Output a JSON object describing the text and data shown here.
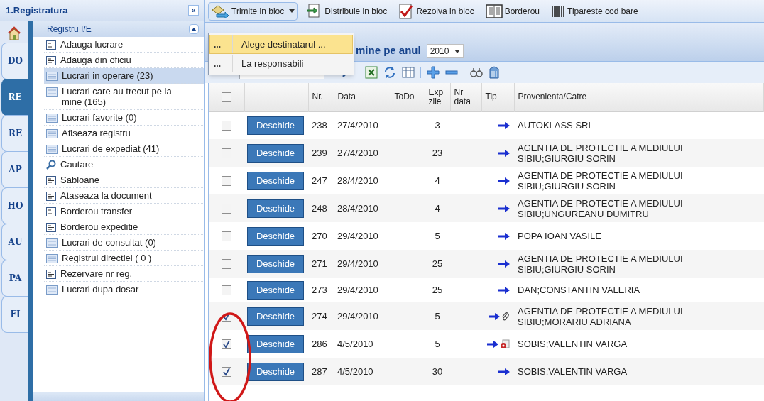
{
  "sidebar": {
    "title": "1.Registratura",
    "collapse": "«",
    "tabs": [
      {
        "label": "DO",
        "selected": false
      },
      {
        "label": "RE",
        "selected": true
      },
      {
        "label": "RE",
        "selected": false
      },
      {
        "label": "AP",
        "selected": false
      },
      {
        "label": "HO",
        "selected": false
      },
      {
        "label": "AU",
        "selected": false
      },
      {
        "label": "PA",
        "selected": false
      },
      {
        "label": "FI",
        "selected": false
      }
    ],
    "panel": {
      "title": "Registru I/E",
      "expanded": true,
      "items": [
        {
          "label": "Adauga lucrare",
          "kind": "form",
          "selected": false
        },
        {
          "label": "Adauga din oficiu",
          "kind": "form",
          "selected": false
        },
        {
          "label": "Lucrari in operare (23)",
          "kind": "list",
          "selected": true
        },
        {
          "label": "Lucrari care au trecut pe la mine (165)",
          "kind": "list",
          "selected": false
        },
        {
          "label": "Lucrari favorite (0)",
          "kind": "list",
          "selected": false
        },
        {
          "label": "Afiseaza registru",
          "kind": "list",
          "selected": false
        },
        {
          "label": "Lucrari de expediat (41)",
          "kind": "list",
          "selected": false
        },
        {
          "label": "Cautare",
          "kind": "search",
          "selected": false
        },
        {
          "label": "Sabloane",
          "kind": "form",
          "selected": false
        },
        {
          "label": "Ataseaza la document",
          "kind": "form",
          "selected": false
        },
        {
          "label": "Borderou transfer",
          "kind": "form",
          "selected": false
        },
        {
          "label": "Borderou expeditie",
          "kind": "form",
          "selected": false
        },
        {
          "label": "Lucrari de consultat (0)",
          "kind": "list",
          "selected": false
        },
        {
          "label": "Registrul directiei ( 0 )",
          "kind": "list",
          "selected": false
        },
        {
          "label": "Rezervare nr reg.",
          "kind": "form",
          "selected": false
        },
        {
          "label": "Lucrari dupa dosar",
          "kind": "list",
          "selected": false
        }
      ]
    }
  },
  "toolbar": [
    {
      "label": "Trimite in bloc",
      "kind": "send",
      "dropdown": true
    },
    {
      "label": "Distribuie in bloc",
      "kind": "distribute",
      "dropdown": false
    },
    {
      "label": "Rezolva in bloc",
      "kind": "resolve",
      "dropdown": false
    },
    {
      "label": "Borderou",
      "kind": "book",
      "dropdown": false
    },
    {
      "label": "Tipareste cod bare",
      "kind": "barcode",
      "dropdown": false
    }
  ],
  "menu": [
    {
      "marker": "...",
      "label": "Alege destinatarul ...",
      "selected": true
    },
    {
      "marker": "...",
      "label": "La responsabili",
      "selected": false
    }
  ],
  "grid_title": {
    "text": "mine pe anul",
    "year": "2010"
  },
  "table": {
    "columns": [
      "Nr.",
      "Data",
      "ToDo",
      "Exp zile",
      "Nr data",
      "Tip",
      "Provenienta/Catre"
    ],
    "all_checked": false,
    "rows": [
      {
        "checked": false,
        "button": "Deschide",
        "nr": "238",
        "data": "27/4/2010",
        "exp": "3",
        "attachment": false,
        "contact": false,
        "from": "AUTOKLASS SRL"
      },
      {
        "checked": false,
        "button": "Deschide",
        "nr": "239",
        "data": "27/4/2010",
        "exp": "23",
        "attachment": false,
        "contact": false,
        "from": "AGENTIA DE PROTECTIE A MEDIULUI SIBIU;GIURGIU SORIN"
      },
      {
        "checked": false,
        "button": "Deschide",
        "nr": "247",
        "data": "28/4/2010",
        "exp": "4",
        "attachment": false,
        "contact": false,
        "from": "AGENTIA DE PROTECTIE A MEDIULUI SIBIU;GIURGIU SORIN"
      },
      {
        "checked": false,
        "button": "Deschide",
        "nr": "248",
        "data": "28/4/2010",
        "exp": "4",
        "attachment": false,
        "contact": false,
        "from": "AGENTIA DE PROTECTIE A MEDIULUI SIBIU;UNGUREANU DUMITRU"
      },
      {
        "checked": false,
        "button": "Deschide",
        "nr": "270",
        "data": "29/4/2010",
        "exp": "5",
        "attachment": false,
        "contact": false,
        "from": "POPA IOAN VASILE"
      },
      {
        "checked": false,
        "button": "Deschide",
        "nr": "271",
        "data": "29/4/2010",
        "exp": "25",
        "attachment": false,
        "contact": false,
        "from": "AGENTIA DE PROTECTIE A MEDIULUI SIBIU;GIURGIU SORIN"
      },
      {
        "checked": false,
        "button": "Deschide",
        "nr": "273",
        "data": "29/4/2010",
        "exp": "25",
        "attachment": false,
        "contact": false,
        "from": "DAN;CONSTANTIN VALERIA"
      },
      {
        "checked": true,
        "button": "Deschide",
        "nr": "274",
        "data": "29/4/2010",
        "exp": "5",
        "attachment": true,
        "contact": false,
        "from": "AGENTIA DE PROTECTIE A MEDIULUI SIBIU;MORARIU ADRIANA"
      },
      {
        "checked": true,
        "button": "Deschide",
        "nr": "286",
        "data": "4/5/2010",
        "exp": "5",
        "attachment": false,
        "contact": true,
        "from": "SOBIS;VALENTIN VARGA"
      },
      {
        "checked": true,
        "button": "Deschide",
        "nr": "287",
        "data": "4/5/2010",
        "exp": "30",
        "attachment": false,
        "contact": false,
        "from": "SOBIS;VALENTIN VARGA"
      }
    ]
  }
}
